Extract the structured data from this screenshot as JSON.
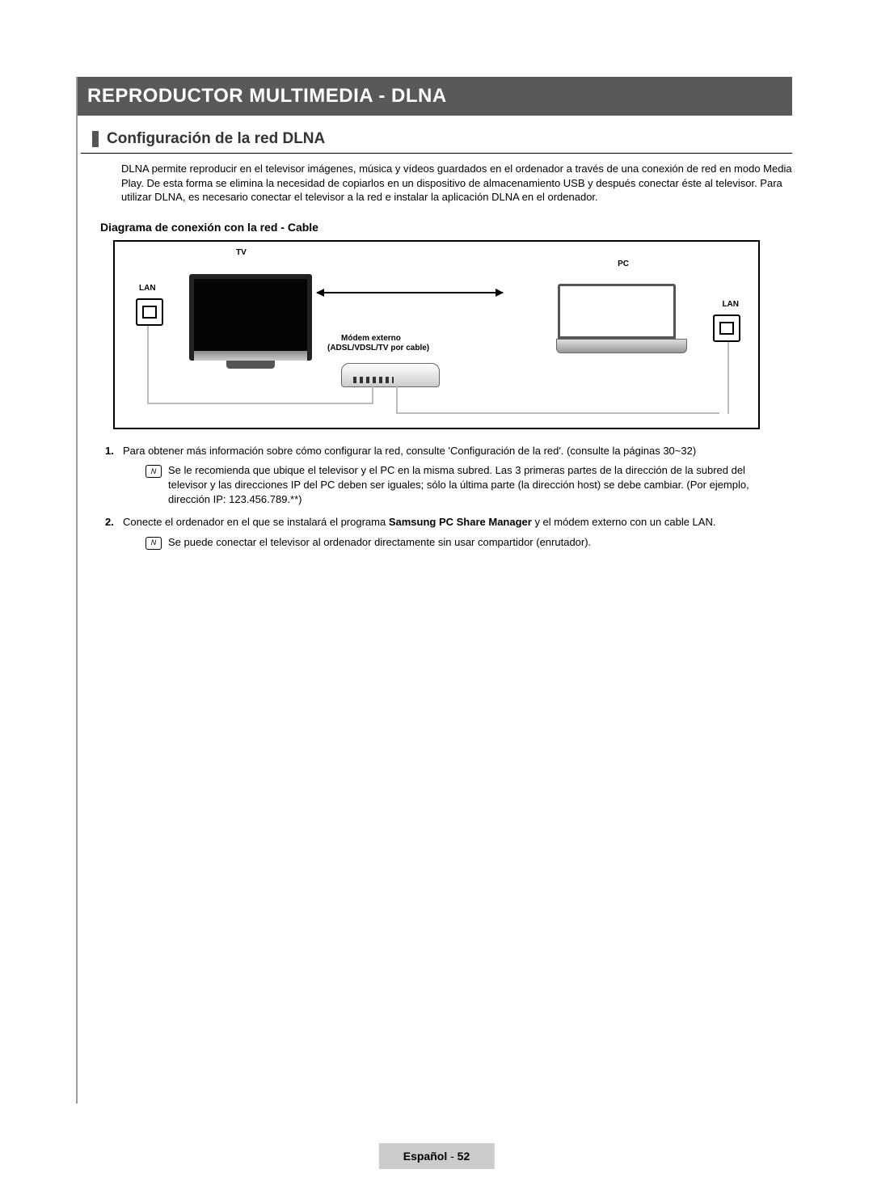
{
  "banner": "REPRODUCTOR MULTIMEDIA - DLNA",
  "section_title": "Configuración de la red DLNA",
  "intro": "DLNA permite reproducir en el televisor imágenes, música y vídeos guardados en el ordenador a través de una conexión de red en modo Media Play. De esta forma se elimina la necesidad de copiarlos en un dispositivo de almacenamiento USB y después conectar éste al televisor. Para utilizar DLNA, es necesario conectar el televisor a la red e instalar la aplicación DLNA en el ordenador.",
  "subhead": "Diagrama de conexión con la red - Cable",
  "diagram": {
    "tv_label": "TV",
    "pc_label": "PC",
    "lan_left": "LAN",
    "lan_right": "LAN",
    "modem_line1": "Módem externo",
    "modem_line2": "(ADSL/VDSL/TV por cable)"
  },
  "steps": {
    "n1": "1.",
    "t1": "Para obtener más información sobre cómo configurar la red, consulte 'Configuración de la red'. (consulte la páginas 30~32)",
    "note1": "Se le recomienda que ubique el televisor y el PC en la misma subred. Las 3 primeras partes de la dirección de la subred del televisor y las direcciones IP del PC deben ser iguales; sólo la última parte (la dirección host) se debe cambiar. (Por ejemplo, dirección IP: 123.456.789.**)",
    "n2": "2.",
    "t2a": "Conecte el ordenador en el que se instalará el programa ",
    "t2b": "Samsung PC Share Manager",
    "t2c": " y el módem externo con un cable LAN.",
    "note2": "Se puede conectar el televisor al ordenador directamente sin usar compartidor (enrutador)."
  },
  "footer": {
    "lang": "Español",
    "dash": " - ",
    "page": "52"
  },
  "note_glyph": "N"
}
